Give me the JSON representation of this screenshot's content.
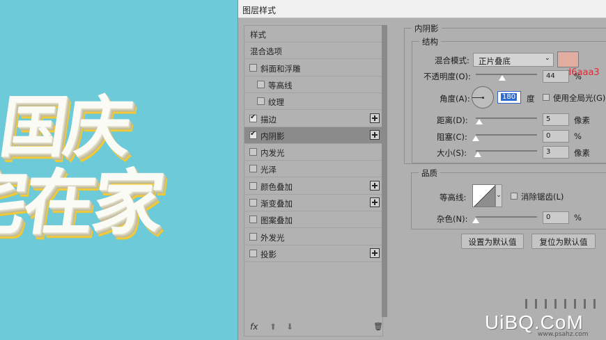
{
  "canvas": {
    "line1": "国庆",
    "line2": "宅在家"
  },
  "dialog": {
    "title": "图层样式"
  },
  "styles_list": [
    {
      "label": "样式",
      "checkbox": false,
      "checked": false,
      "plus": false,
      "selected": false
    },
    {
      "label": "混合选项",
      "checkbox": false,
      "checked": false,
      "plus": false,
      "selected": false
    },
    {
      "label": "斜面和浮雕",
      "checkbox": true,
      "checked": false,
      "plus": false,
      "selected": false
    },
    {
      "label": "等高线",
      "checkbox": true,
      "checked": false,
      "plus": false,
      "selected": false
    },
    {
      "label": "纹理",
      "checkbox": true,
      "checked": false,
      "plus": false,
      "selected": false
    },
    {
      "label": "描边",
      "checkbox": true,
      "checked": true,
      "plus": true,
      "selected": false
    },
    {
      "label": "内阴影",
      "checkbox": true,
      "checked": true,
      "plus": true,
      "selected": true
    },
    {
      "label": "内发光",
      "checkbox": true,
      "checked": false,
      "plus": false,
      "selected": false
    },
    {
      "label": "光泽",
      "checkbox": true,
      "checked": false,
      "plus": false,
      "selected": false
    },
    {
      "label": "颜色叠加",
      "checkbox": true,
      "checked": false,
      "plus": true,
      "selected": false
    },
    {
      "label": "渐变叠加",
      "checkbox": true,
      "checked": false,
      "plus": true,
      "selected": false
    },
    {
      "label": "图案叠加",
      "checkbox": true,
      "checked": false,
      "plus": false,
      "selected": false
    },
    {
      "label": "外发光",
      "checkbox": true,
      "checked": false,
      "plus": false,
      "selected": false
    },
    {
      "label": "投影",
      "checkbox": true,
      "checked": false,
      "plus": true,
      "selected": false
    }
  ],
  "bottom": {
    "fx": "fx",
    "up": "⬆",
    "down": "⬇",
    "trash": "🗑"
  },
  "inner_shadow": {
    "section_title": "内阴影",
    "structure_title": "结构",
    "blend_mode_label": "混合模式:",
    "blend_mode_value": "正片叠底",
    "color_hex": "#e3ada2",
    "color_note": "d6aaa3",
    "opacity_label": "不透明度(O):",
    "opacity_value": "44",
    "opacity_unit": "%",
    "angle_label": "角度(A):",
    "angle_value": "180",
    "angle_unit": "度",
    "global_light_label": "使用全局光(G)",
    "distance_label": "距离(D):",
    "distance_value": "5",
    "distance_unit": "像素",
    "choke_label": "阻塞(C):",
    "choke_value": "0",
    "choke_unit": "%",
    "size_label": "大小(S):",
    "size_value": "3",
    "size_unit": "像素",
    "quality_title": "品质",
    "contour_label": "等高线:",
    "antialias_label": "消除锯齿(L)",
    "noise_label": "杂色(N):",
    "noise_value": "0",
    "noise_unit": "%",
    "make_default": "设置为默认值",
    "reset_default": "复位为默认值"
  },
  "watermark": {
    "logo": "UiBQ.CoM",
    "site": "www.psahz.com"
  }
}
